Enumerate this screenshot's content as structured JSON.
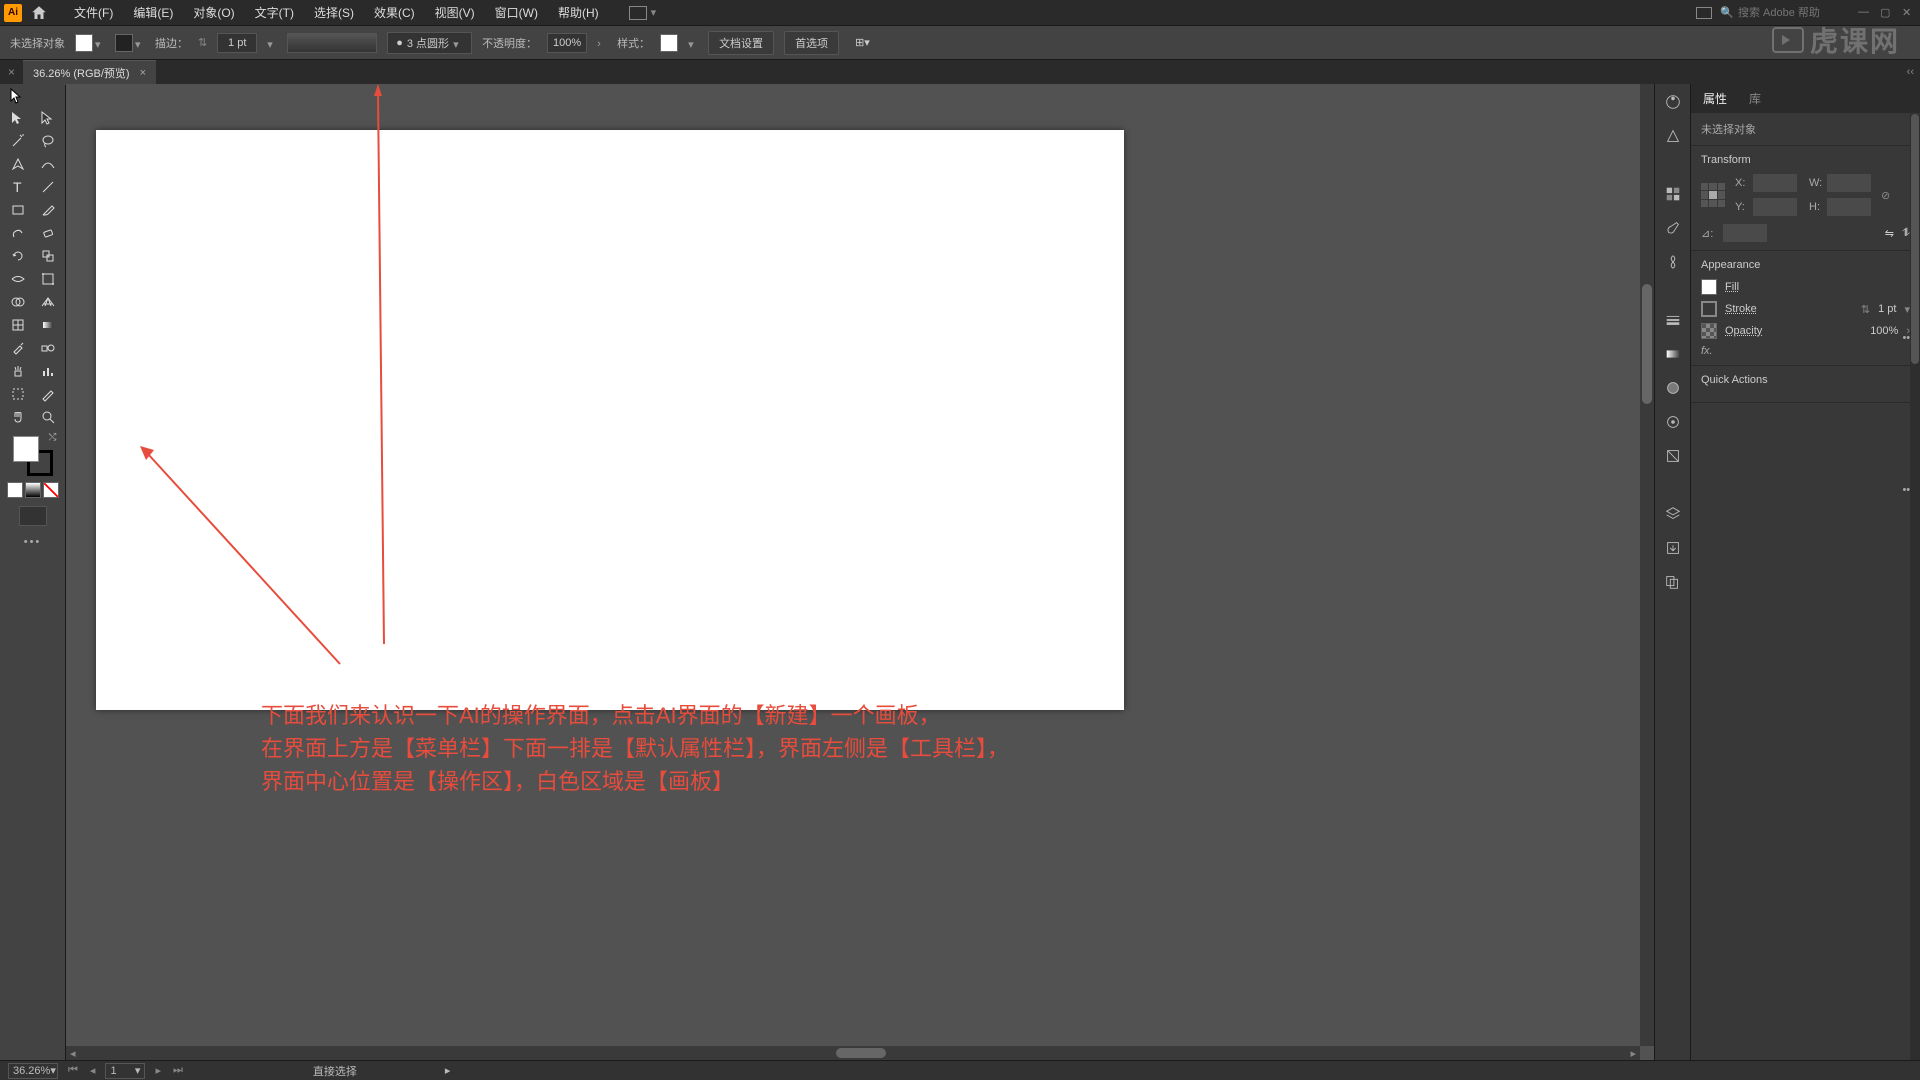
{
  "menubar": {
    "items": [
      "文件(F)",
      "编辑(E)",
      "对象(O)",
      "文字(T)",
      "选择(S)",
      "效果(C)",
      "视图(V)",
      "窗口(W)",
      "帮助(H)"
    ],
    "search_placeholder": "搜索 Adobe 帮助"
  },
  "controlbar": {
    "no_selection": "未选择对象",
    "stroke_label": "描边：",
    "stroke_weight": "1 pt",
    "brush_label": "3 点圆形",
    "opacity_label": "不透明度：",
    "opacity_value": "100%",
    "style_label": "样式：",
    "doc_setup": "文档设置",
    "prefs": "首选项"
  },
  "document": {
    "tab_label": "36.26% (RGB/预览)"
  },
  "annotation": {
    "line1": "下面我们来认识一下AI的操作界面，点击AI界面的【新建】一个画板，",
    "line2": "在界面上方是【菜单栏】下面一排是【默认属性栏】，界面左侧是【工具栏】，",
    "line3": "界面中心位置是【操作区】，白色区域是【画板】"
  },
  "properties": {
    "tabs": [
      "属性",
      "库"
    ],
    "no_selection": "未选择对象",
    "transform": {
      "heading": "Transform",
      "x_lbl": "X:",
      "x_val": "",
      "y_lbl": "Y:",
      "y_val": "",
      "w_lbl": "W:",
      "w_val": "",
      "h_lbl": "H:",
      "h_val": "",
      "angle_lbl": "⊿:"
    },
    "appearance": {
      "heading": "Appearance",
      "fill": "Fill",
      "stroke": "Stroke",
      "stroke_val": "1 pt",
      "opacity": "Opacity",
      "opacity_val": "100%",
      "fx": "fx."
    },
    "quick_actions": "Quick Actions"
  },
  "statusbar": {
    "zoom": "36.26%",
    "artboard_num": "1",
    "tool": "直接选择"
  },
  "watermark": "虎课网"
}
